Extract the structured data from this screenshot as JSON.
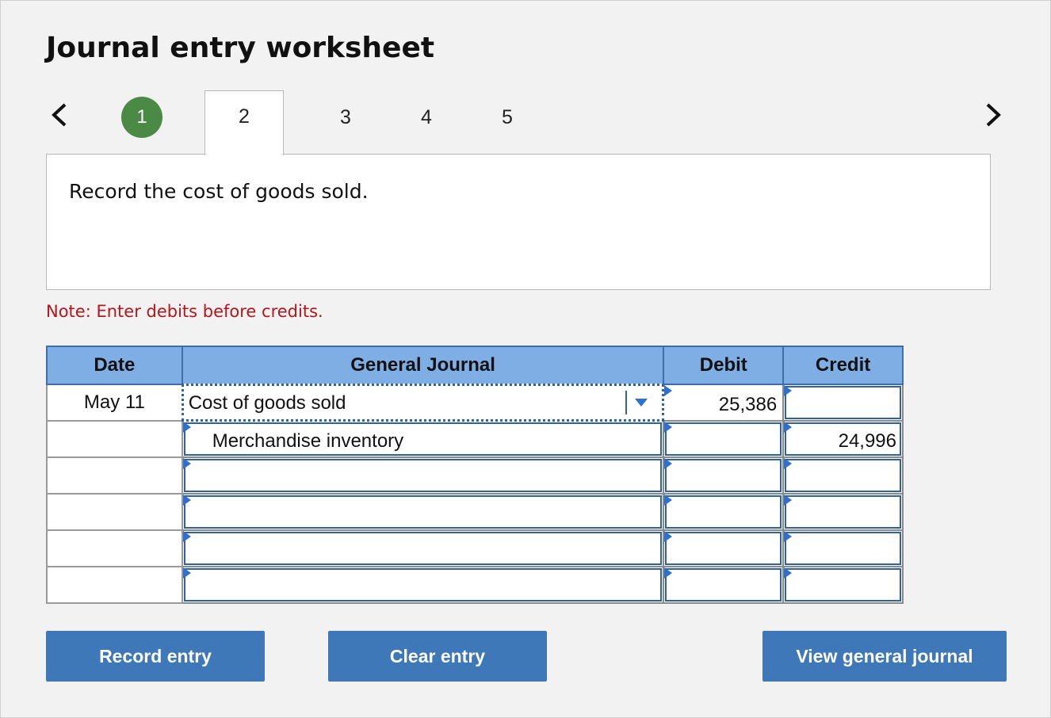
{
  "title": "Journal entry worksheet",
  "steps": [
    "1",
    "2",
    "3",
    "4",
    "5"
  ],
  "step_status": {
    "completed": "1",
    "current": "2"
  },
  "instruction": "Record the cost of goods sold.",
  "note": "Note: Enter debits before credits.",
  "table": {
    "headers": {
      "date": "Date",
      "general_journal": "General Journal",
      "debit": "Debit",
      "credit": "Credit"
    },
    "rows": [
      {
        "date": "May 11",
        "account": "Cost of goods sold",
        "debit": "25,386",
        "credit": ""
      },
      {
        "date": "",
        "account": "Merchandise inventory",
        "debit": "",
        "credit": "24,996"
      },
      {
        "date": "",
        "account": "",
        "debit": "",
        "credit": ""
      },
      {
        "date": "",
        "account": "",
        "debit": "",
        "credit": ""
      },
      {
        "date": "",
        "account": "",
        "debit": "",
        "credit": ""
      },
      {
        "date": "",
        "account": "",
        "debit": "",
        "credit": ""
      }
    ]
  },
  "buttons": {
    "record": "Record entry",
    "clear": "Clear entry",
    "view": "View general journal"
  },
  "colors": {
    "completed_step": "#4a8a45",
    "header_bg": "#7eaee4",
    "button_bg": "#3e78b8",
    "note_text": "#b8141b"
  }
}
